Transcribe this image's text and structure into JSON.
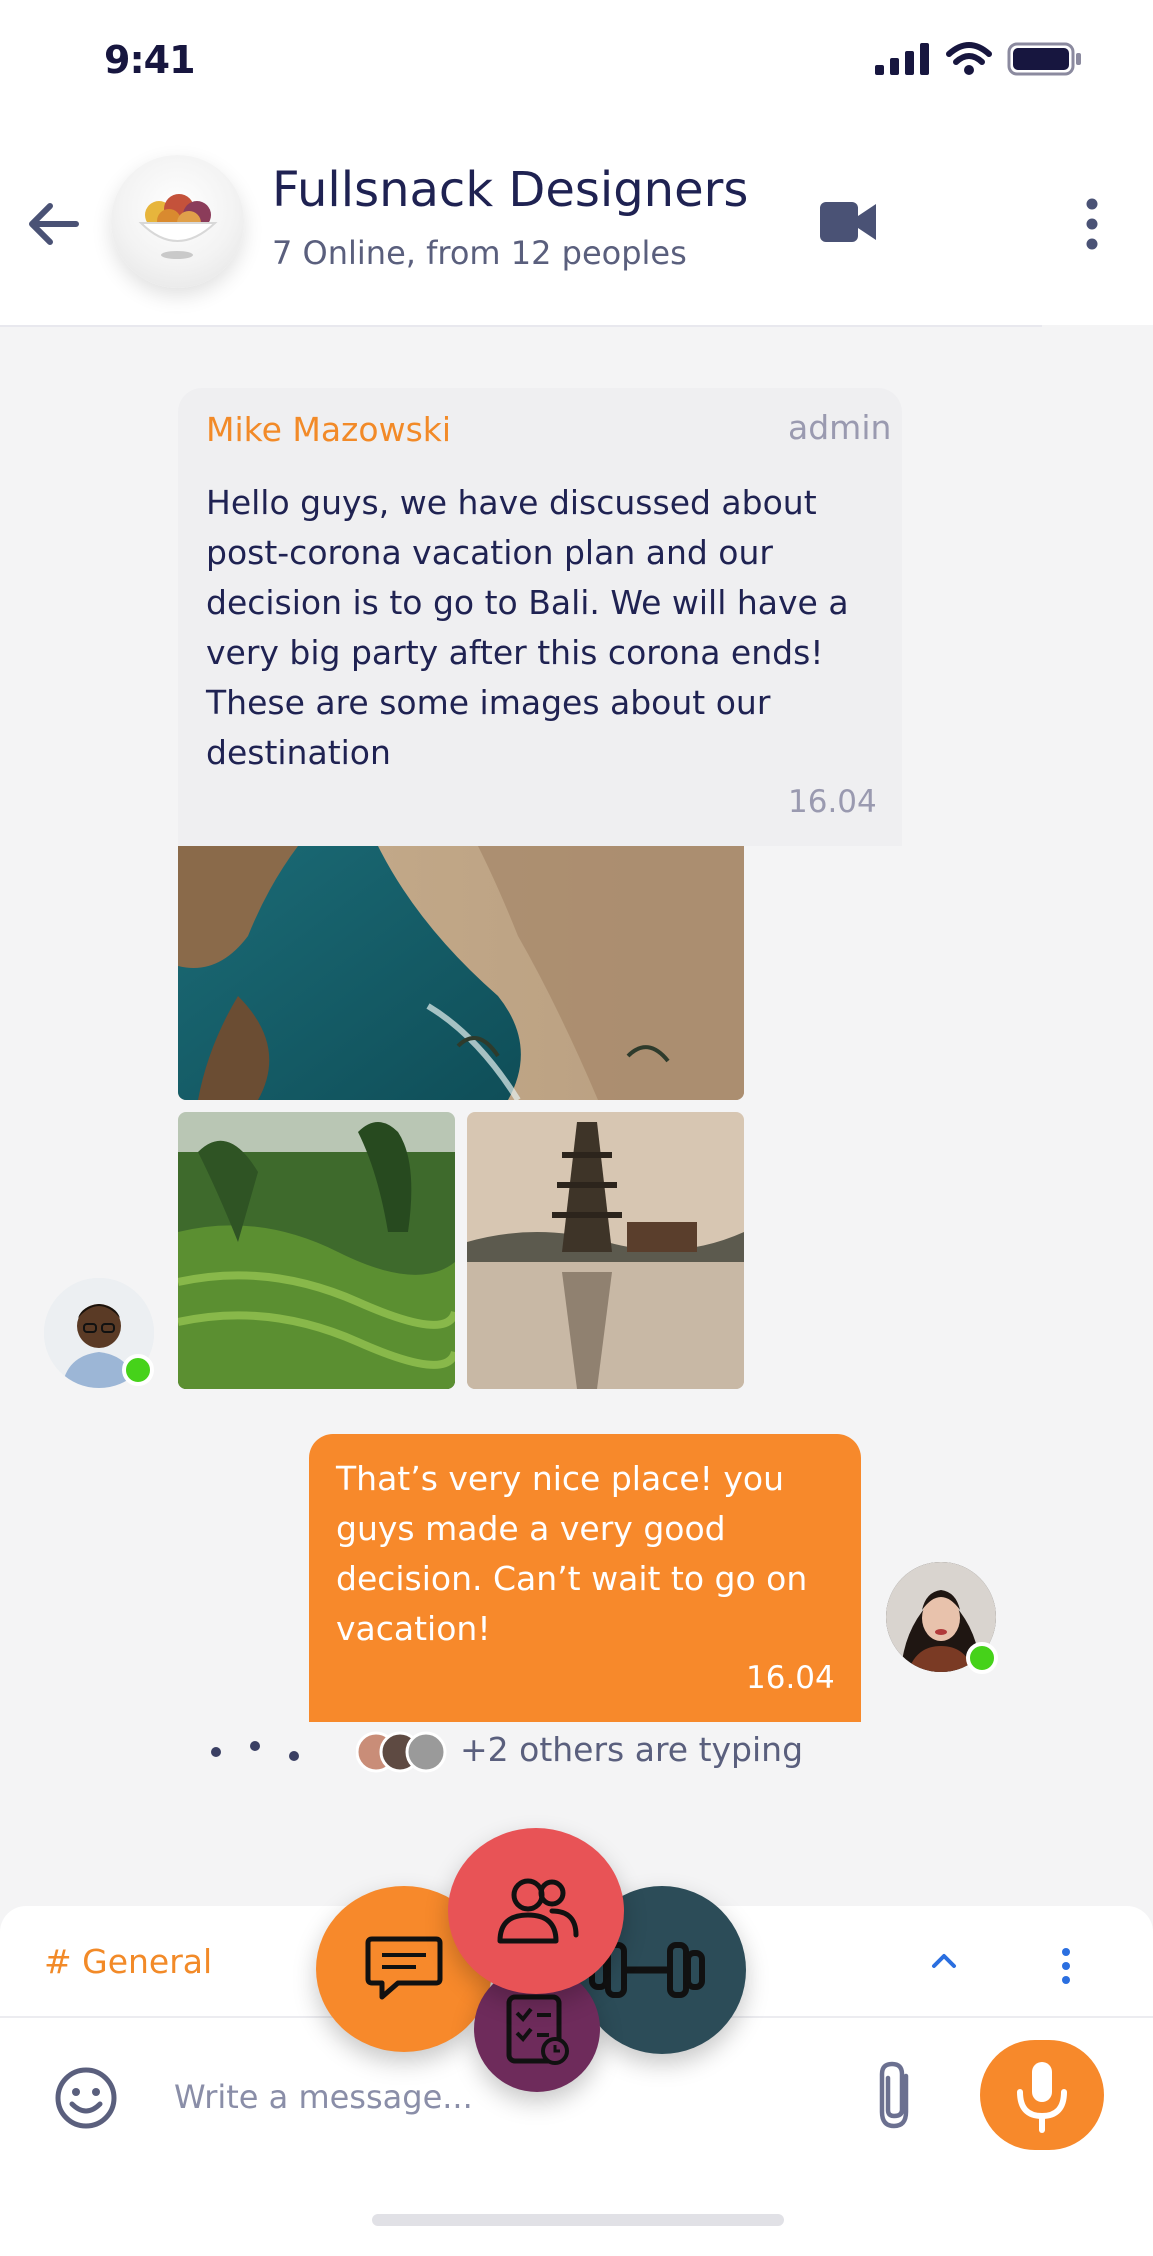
{
  "status_bar": {
    "time": "9:41",
    "icons": [
      "signal-icon",
      "wifi-icon",
      "battery-icon"
    ]
  },
  "header": {
    "title": "Fullsnack Designers",
    "subtitle": "7 Online, from 12 peoples",
    "icons": [
      "back-arrow-icon",
      "video-camera-icon",
      "more-vertical-icon"
    ]
  },
  "messages": [
    {
      "sender": "Mike Mazowski",
      "role": "admin",
      "text": "Hello guys, we have discussed about post-corona vacation plan and our decision is to go to Bali. We will have a very big party after this corona ends! These are some images about our destination",
      "time": "16.04",
      "images": [
        "bali-coast-cliff",
        "rice-terraces",
        "water-temple"
      ]
    },
    {
      "text": "That’s very nice place! you guys made a very good decision. Can’t wait to go on vacation!",
      "time": "16.04"
    }
  ],
  "typing": {
    "text": "+2 others are typing"
  },
  "channel": {
    "label": "# General"
  },
  "composer": {
    "placeholder": "Write a message..."
  },
  "fab_menu": {
    "icons": [
      "chat-icon",
      "people-icon",
      "dumbbell-icon",
      "task-list-icon"
    ]
  },
  "colors": {
    "accent": "#f7892b",
    "primary_text": "#1f2252",
    "secondary_text": "#5a5f7d",
    "online": "#46d21a",
    "fab_chat": "#f7892b",
    "fab_people": "#e85356",
    "fab_gym": "#2c4c58",
    "fab_tasks": "#6e2b5b"
  }
}
